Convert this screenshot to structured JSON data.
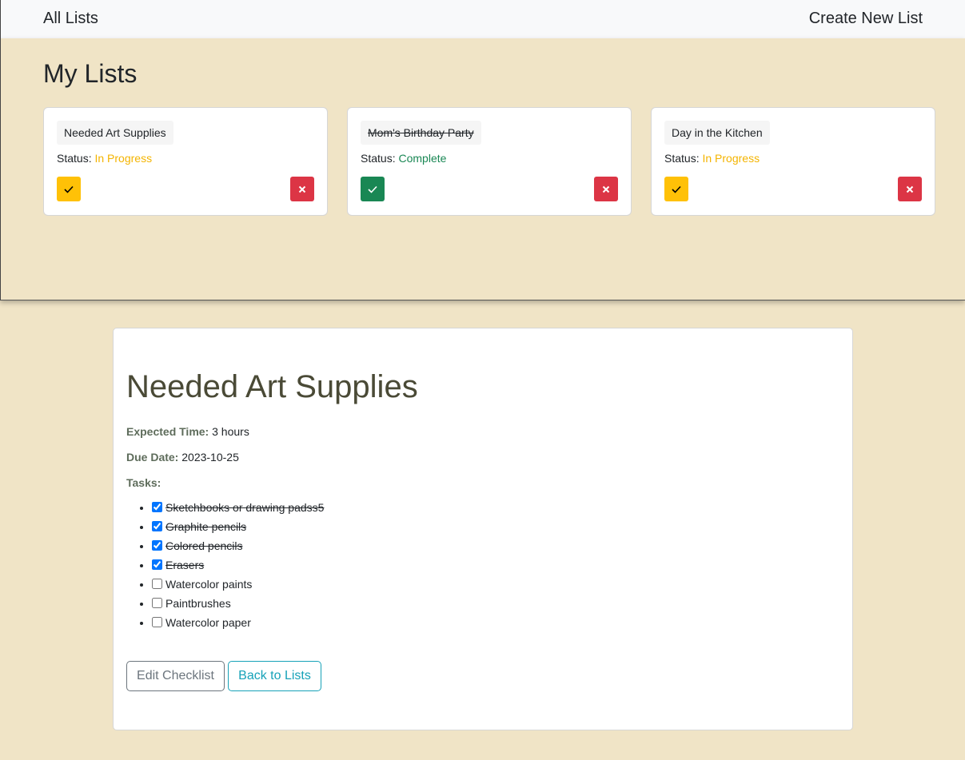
{
  "nav": {
    "all_lists": "All Lists",
    "create_new": "Create New List"
  },
  "lists_panel": {
    "title": "My Lists",
    "status_label": "Status:",
    "cards": [
      {
        "name": "Needed Art Supplies",
        "status": "In Progress",
        "done": false
      },
      {
        "name": "Mom's Birthday Party",
        "status": "Complete",
        "done": true
      },
      {
        "name": "Day in the Kitchen",
        "status": "In Progress",
        "done": false
      }
    ]
  },
  "detail": {
    "title": "Needed Art Supplies",
    "expected_time_label": "Expected Time:",
    "expected_time": "3 hours",
    "due_date_label": "Due Date:",
    "due_date": "2023-10-25",
    "tasks_label": "Tasks:",
    "tasks": [
      {
        "label": "Sketchbooks or drawing padss5",
        "checked": true
      },
      {
        "label": "Graphite pencils",
        "checked": true
      },
      {
        "label": "Colored pencils",
        "checked": true
      },
      {
        "label": "Erasers",
        "checked": true
      },
      {
        "label": "Watercolor paints",
        "checked": false
      },
      {
        "label": "Paintbrushes",
        "checked": false
      },
      {
        "label": "Watercolor paper",
        "checked": false
      }
    ],
    "edit_button": "Edit Checklist",
    "back_button": "Back to Lists"
  },
  "colors": {
    "background": "#f0e4c6",
    "in_progress": "#f4b400",
    "complete": "#198754",
    "check_yellow": "#ffc107",
    "check_green": "#198754",
    "delete_red": "#dc3545",
    "back_button": "#17a2b8",
    "edit_button": "#6c757d"
  },
  "icons": {
    "check": "check-icon",
    "delete": "close-icon"
  }
}
